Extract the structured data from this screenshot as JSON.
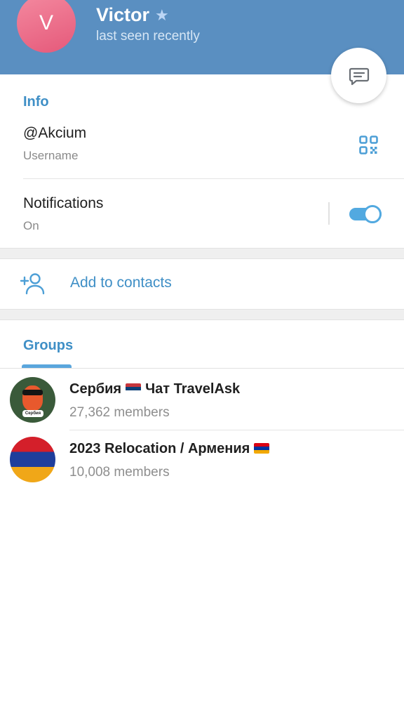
{
  "header": {
    "avatar_letter": "V",
    "name": "Victor",
    "status": "last seen recently",
    "star_icon": "star-icon",
    "bg_color": "#5a8fc1"
  },
  "fab": {
    "icon": "chat-icon"
  },
  "info": {
    "section_title": "Info",
    "username_value": "@Akcium",
    "username_label": "Username",
    "qr_icon": "qr-code-icon",
    "notifications_label": "Notifications",
    "notifications_value": "On",
    "notifications_enabled": true
  },
  "contacts": {
    "add_label": "Add to contacts",
    "add_icon": "add-person-icon"
  },
  "groups": {
    "tab_label": "Groups",
    "items": [
      {
        "title_part1": "Сербия",
        "flag": "serbia-flag",
        "title_part2": "Чат TravelAsk",
        "members": "27,362 members",
        "avatar_tag": "Сербия"
      },
      {
        "title_part1": "2023 Relocation / Армения",
        "flag": "armenia-flag",
        "members": "10,008 members"
      }
    ]
  },
  "accent_color": "#3f8fc6"
}
